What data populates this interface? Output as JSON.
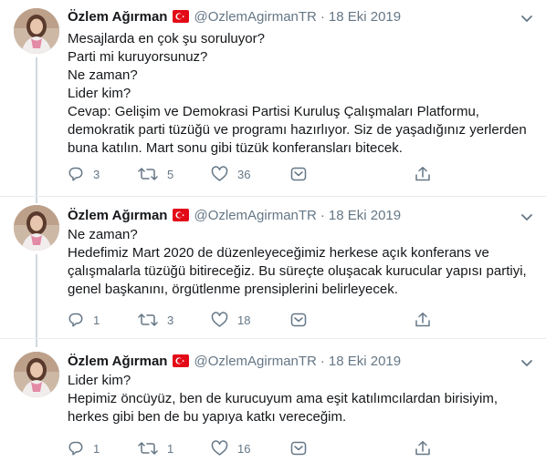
{
  "tweets": [
    {
      "name": "Özlem Ağırman",
      "handle": "@OzlemAgirmanTR",
      "date": "18 Eki 2019",
      "lines": [
        "Mesajlarda en çok şu soruluyor?",
        "Parti mi kuruyorsunuz?",
        "Ne zaman?",
        "Lider kim?",
        "Cevap: Gelişim ve Demokrasi Partisi Kuruluş Çalışmaları Platformu,",
        "demokratik parti tüzüğü ve programı hazırlıyor. Siz de yaşadığınız yerlerden",
        "buna katılın. Mart sonu gibi tüzük konferansları bitecek."
      ],
      "replies": "3",
      "retweets": "5",
      "likes": "36"
    },
    {
      "name": "Özlem Ağırman",
      "handle": "@OzlemAgirmanTR",
      "date": "18 Eki 2019",
      "lines": [
        "Ne zaman?",
        "Hedefimiz Mart 2020 de düzenleyeceğimiz herkese açık konferans ve",
        "çalışmalarla tüzüğü bitireceğiz. Bu süreçte oluşacak kurucular yapısı partiyi,",
        "genel başkanını, örgütlenme prensiplerini belirleyecek."
      ],
      "replies": "1",
      "retweets": "3",
      "likes": "18"
    },
    {
      "name": "Özlem Ağırman",
      "handle": "@OzlemAgirmanTR",
      "date": "18 Eki 2019",
      "lines": [
        "Lider kim?",
        "Hepimiz öncüyüz, ben de kurucuyum ama eşit katılımcılardan birisiyim,",
        "herkes gibi ben de bu yapıya katkı vereceğim."
      ],
      "replies": "1",
      "retweets": "1",
      "likes": "16"
    }
  ],
  "colors": {
    "text": "#14171a",
    "muted": "#657786",
    "flag_red": "#e30a17",
    "divider": "#e6ecf0",
    "thread": "#cfd9de"
  },
  "icons": [
    "turkey-flag-icon",
    "chevron-down-icon",
    "reply-icon",
    "retweet-icon",
    "like-icon",
    "message-icon",
    "share-icon"
  ]
}
